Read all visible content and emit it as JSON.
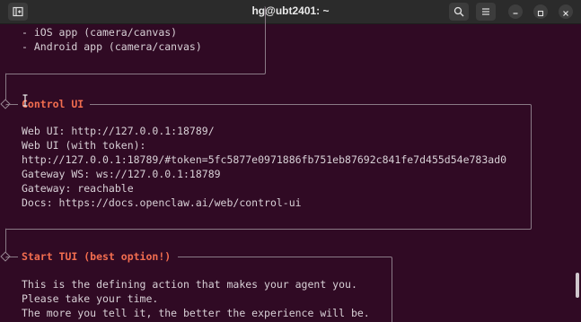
{
  "window": {
    "title": "hg@ubt2401: ~"
  },
  "icons": {
    "new_tab": "new-tab-icon",
    "search": "search-icon",
    "menu": "hamburger-menu-icon",
    "minimize": "minimize-icon",
    "maximize": "maximize-icon",
    "close": "close-icon"
  },
  "colors": {
    "terminal_bg": "#300a24",
    "heading": "#f26d4f",
    "text": "#d8d0d6"
  },
  "sections": {
    "apps": {
      "lines": [
        "- iOS app (camera/canvas)",
        "- Android app (camera/canvas)"
      ]
    },
    "control_ui": {
      "heading": "Control UI",
      "lines": [
        "Web UI: http://127.0.0.1:18789/",
        "Web UI (with token):",
        "http://127.0.0.1:18789/#token=5fc5877e0971886fb751eb87692c841fe7d455d54e783ad0",
        "Gateway WS: ws://127.0.0.1:18789",
        "Gateway: reachable",
        "Docs: https://docs.openclaw.ai/web/control-ui"
      ]
    },
    "start_tui": {
      "heading": "Start TUI (best option!)",
      "lines": [
        "This is the defining action that makes your agent you.",
        "Please take your time.",
        "The more you tell it, the better the experience will be."
      ]
    }
  }
}
